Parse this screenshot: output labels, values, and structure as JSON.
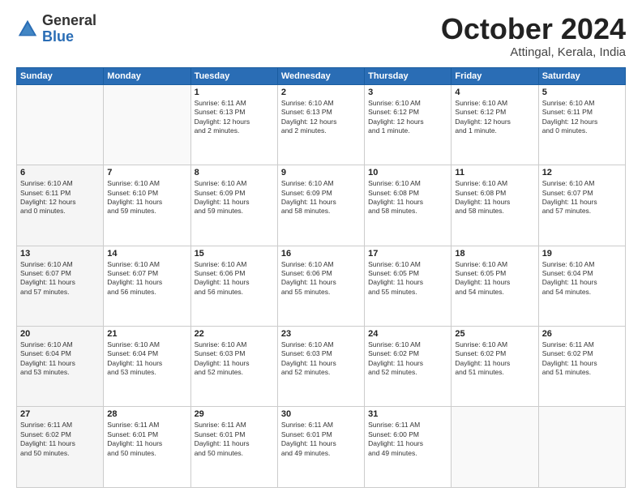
{
  "logo": {
    "general": "General",
    "blue": "Blue"
  },
  "title": "October 2024",
  "subtitle": "Attingal, Kerala, India",
  "headers": [
    "Sunday",
    "Monday",
    "Tuesday",
    "Wednesday",
    "Thursday",
    "Friday",
    "Saturday"
  ],
  "weeks": [
    [
      {
        "day": "",
        "info": ""
      },
      {
        "day": "",
        "info": ""
      },
      {
        "day": "1",
        "info": "Sunrise: 6:11 AM\nSunset: 6:13 PM\nDaylight: 12 hours\nand 2 minutes."
      },
      {
        "day": "2",
        "info": "Sunrise: 6:10 AM\nSunset: 6:13 PM\nDaylight: 12 hours\nand 2 minutes."
      },
      {
        "day": "3",
        "info": "Sunrise: 6:10 AM\nSunset: 6:12 PM\nDaylight: 12 hours\nand 1 minute."
      },
      {
        "day": "4",
        "info": "Sunrise: 6:10 AM\nSunset: 6:12 PM\nDaylight: 12 hours\nand 1 minute."
      },
      {
        "day": "5",
        "info": "Sunrise: 6:10 AM\nSunset: 6:11 PM\nDaylight: 12 hours\nand 0 minutes."
      }
    ],
    [
      {
        "day": "6",
        "info": "Sunrise: 6:10 AM\nSunset: 6:11 PM\nDaylight: 12 hours\nand 0 minutes."
      },
      {
        "day": "7",
        "info": "Sunrise: 6:10 AM\nSunset: 6:10 PM\nDaylight: 11 hours\nand 59 minutes."
      },
      {
        "day": "8",
        "info": "Sunrise: 6:10 AM\nSunset: 6:09 PM\nDaylight: 11 hours\nand 59 minutes."
      },
      {
        "day": "9",
        "info": "Sunrise: 6:10 AM\nSunset: 6:09 PM\nDaylight: 11 hours\nand 58 minutes."
      },
      {
        "day": "10",
        "info": "Sunrise: 6:10 AM\nSunset: 6:08 PM\nDaylight: 11 hours\nand 58 minutes."
      },
      {
        "day": "11",
        "info": "Sunrise: 6:10 AM\nSunset: 6:08 PM\nDaylight: 11 hours\nand 58 minutes."
      },
      {
        "day": "12",
        "info": "Sunrise: 6:10 AM\nSunset: 6:07 PM\nDaylight: 11 hours\nand 57 minutes."
      }
    ],
    [
      {
        "day": "13",
        "info": "Sunrise: 6:10 AM\nSunset: 6:07 PM\nDaylight: 11 hours\nand 57 minutes."
      },
      {
        "day": "14",
        "info": "Sunrise: 6:10 AM\nSunset: 6:07 PM\nDaylight: 11 hours\nand 56 minutes."
      },
      {
        "day": "15",
        "info": "Sunrise: 6:10 AM\nSunset: 6:06 PM\nDaylight: 11 hours\nand 56 minutes."
      },
      {
        "day": "16",
        "info": "Sunrise: 6:10 AM\nSunset: 6:06 PM\nDaylight: 11 hours\nand 55 minutes."
      },
      {
        "day": "17",
        "info": "Sunrise: 6:10 AM\nSunset: 6:05 PM\nDaylight: 11 hours\nand 55 minutes."
      },
      {
        "day": "18",
        "info": "Sunrise: 6:10 AM\nSunset: 6:05 PM\nDaylight: 11 hours\nand 54 minutes."
      },
      {
        "day": "19",
        "info": "Sunrise: 6:10 AM\nSunset: 6:04 PM\nDaylight: 11 hours\nand 54 minutes."
      }
    ],
    [
      {
        "day": "20",
        "info": "Sunrise: 6:10 AM\nSunset: 6:04 PM\nDaylight: 11 hours\nand 53 minutes."
      },
      {
        "day": "21",
        "info": "Sunrise: 6:10 AM\nSunset: 6:04 PM\nDaylight: 11 hours\nand 53 minutes."
      },
      {
        "day": "22",
        "info": "Sunrise: 6:10 AM\nSunset: 6:03 PM\nDaylight: 11 hours\nand 52 minutes."
      },
      {
        "day": "23",
        "info": "Sunrise: 6:10 AM\nSunset: 6:03 PM\nDaylight: 11 hours\nand 52 minutes."
      },
      {
        "day": "24",
        "info": "Sunrise: 6:10 AM\nSunset: 6:02 PM\nDaylight: 11 hours\nand 52 minutes."
      },
      {
        "day": "25",
        "info": "Sunrise: 6:10 AM\nSunset: 6:02 PM\nDaylight: 11 hours\nand 51 minutes."
      },
      {
        "day": "26",
        "info": "Sunrise: 6:11 AM\nSunset: 6:02 PM\nDaylight: 11 hours\nand 51 minutes."
      }
    ],
    [
      {
        "day": "27",
        "info": "Sunrise: 6:11 AM\nSunset: 6:02 PM\nDaylight: 11 hours\nand 50 minutes."
      },
      {
        "day": "28",
        "info": "Sunrise: 6:11 AM\nSunset: 6:01 PM\nDaylight: 11 hours\nand 50 minutes."
      },
      {
        "day": "29",
        "info": "Sunrise: 6:11 AM\nSunset: 6:01 PM\nDaylight: 11 hours\nand 50 minutes."
      },
      {
        "day": "30",
        "info": "Sunrise: 6:11 AM\nSunset: 6:01 PM\nDaylight: 11 hours\nand 49 minutes."
      },
      {
        "day": "31",
        "info": "Sunrise: 6:11 AM\nSunset: 6:00 PM\nDaylight: 11 hours\nand 49 minutes."
      },
      {
        "day": "",
        "info": ""
      },
      {
        "day": "",
        "info": ""
      }
    ]
  ]
}
